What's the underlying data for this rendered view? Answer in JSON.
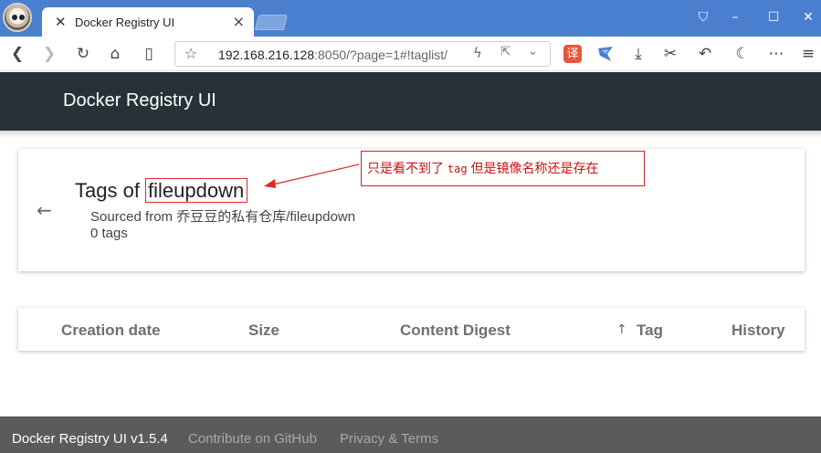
{
  "browser": {
    "tab_title": "Docker Registry UI",
    "tab_icon": "docker-registry-icon",
    "address": {
      "host": "192.168.216.128",
      "rest": ":8050/?page=1#!taglist/"
    },
    "translate_label": "译",
    "colors": {
      "titlebar": "#4a7fd0"
    }
  },
  "header": {
    "title": "Docker Registry UI"
  },
  "tags_card": {
    "title_prefix": "Tags of ",
    "repo_name": "fileupdown",
    "sourced_from": "Sourced from 乔豆豆的私有仓库/fileupdown",
    "tag_count": "0 tags"
  },
  "annotation": {
    "text_before": "只是看不到了 ",
    "text_mono": "tag",
    "text_after": " 但是镜像名称还是存在",
    "color": "#cc1111"
  },
  "table": {
    "columns": [
      "Creation date",
      "Size",
      "Content Digest",
      "Tag",
      "History"
    ],
    "sorted_column": "Tag",
    "sort_direction": "ascending"
  },
  "footer": {
    "version": "Docker Registry UI v1.5.4",
    "github": "Contribute on GitHub",
    "privacy": "Privacy & Terms"
  }
}
